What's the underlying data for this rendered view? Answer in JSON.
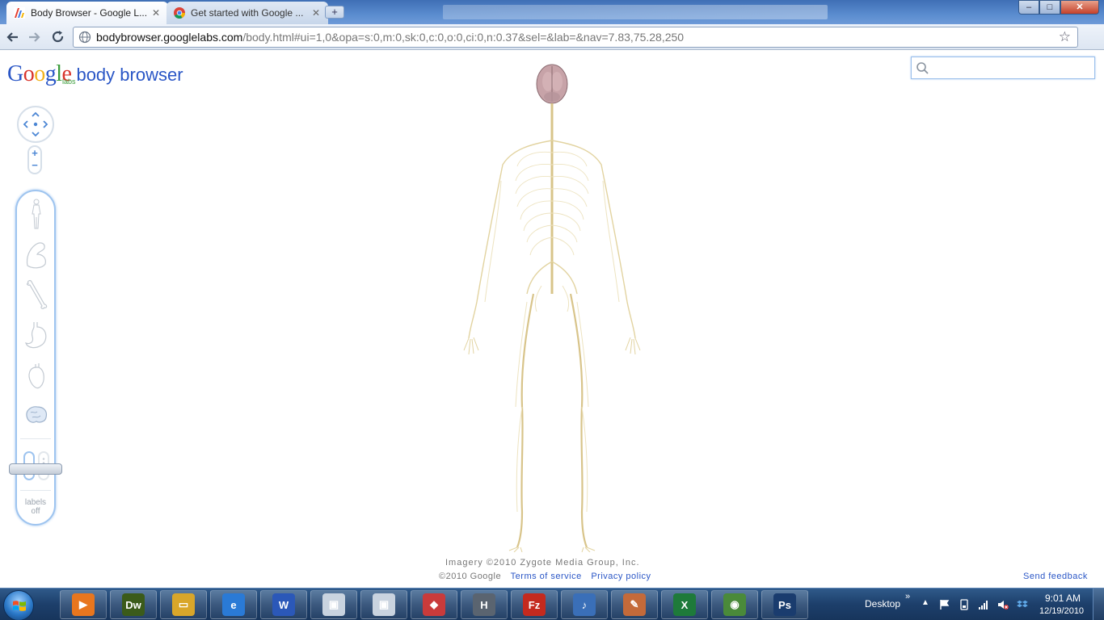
{
  "browser": {
    "tabs": [
      {
        "title": "Body Browser - Google L...",
        "active": true
      },
      {
        "title": "Get started with Google ...",
        "active": false
      }
    ],
    "new_tab_label": "+",
    "window_controls": {
      "minimize": "–",
      "maximize": "□",
      "close": "✕"
    },
    "url_domain": "bodybrowser.googlelabs.com",
    "url_path": "/body.html#ui=1,0&opa=s:0,m:0,sk:0,c:0,o:0,ci:0,n:0.37&sel=&lab=&nav=7.83,75.28,250"
  },
  "page": {
    "logo": {
      "google": "Google",
      "labs": "labs",
      "product": "body browser"
    },
    "search": {
      "placeholder": "",
      "value": ""
    },
    "zoom": {
      "in": "+",
      "out": "−"
    },
    "layers": {
      "labels_toggle": [
        "labels",
        "off"
      ]
    },
    "footer": {
      "imagery": "Imagery ©2010 Zygote Media Group, Inc.",
      "copyright": "©2010 Google",
      "terms": "Terms of service",
      "privacy": "Privacy policy",
      "feedback": "Send feedback"
    }
  },
  "taskbar": {
    "apps": [
      {
        "name": "media-player-icon",
        "color": "#e8761e",
        "glyph": "▶"
      },
      {
        "name": "dreamweaver-icon",
        "color": "#3b5b1a",
        "glyph": "Dw"
      },
      {
        "name": "explorer-icon",
        "color": "#d9a62a",
        "glyph": "▭"
      },
      {
        "name": "internet-explorer-icon",
        "color": "#2a7ad6",
        "glyph": "e"
      },
      {
        "name": "word-icon",
        "color": "#2b58b8",
        "glyph": "W"
      },
      {
        "name": "app-window-icon",
        "color": "#c9d3df",
        "glyph": "▣"
      },
      {
        "name": "app-window-2-icon",
        "color": "#c9d3df",
        "glyph": "▣"
      },
      {
        "name": "package-icon",
        "color": "#c93b3b",
        "glyph": "◆"
      },
      {
        "name": "h-app-icon",
        "color": "#5a6470",
        "glyph": "H"
      },
      {
        "name": "filezilla-icon",
        "color": "#c42a1e",
        "glyph": "Fz"
      },
      {
        "name": "itunes-icon",
        "color": "#3a6fb8",
        "glyph": "♪"
      },
      {
        "name": "paint-icon",
        "color": "#c46a3a",
        "glyph": "✎"
      },
      {
        "name": "excel-icon",
        "color": "#1e7a3a",
        "glyph": "X"
      },
      {
        "name": "chrome-icon",
        "color": "#4a8a3a",
        "glyph": "◉"
      },
      {
        "name": "photoshop-icon",
        "color": "#1a3c6e",
        "glyph": "Ps"
      }
    ],
    "tray": {
      "desktop": "Desktop",
      "chevron": "»",
      "time": "9:01 AM",
      "date": "12/19/2010"
    }
  }
}
